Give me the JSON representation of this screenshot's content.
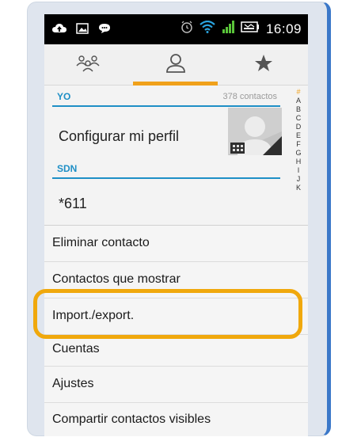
{
  "status_bar": {
    "time": "16:09",
    "left_icons": [
      "cloud-upload-icon",
      "image-icon",
      "chat-bubble-icon"
    ],
    "right_icons": [
      "alarm-icon",
      "wifi-icon",
      "signal-icon",
      "battery-icon"
    ]
  },
  "tabs": [
    {
      "icon": "groups-icon",
      "active": false
    },
    {
      "icon": "person-icon",
      "active": true
    },
    {
      "icon": "star-icon",
      "active": false
    }
  ],
  "contacts": {
    "sections": [
      {
        "title": "YO",
        "count": "378 contactos",
        "rows": [
          "Configurar mi perfil"
        ]
      },
      {
        "title": "SDN",
        "rows": [
          "*611"
        ]
      }
    ],
    "index_letters": [
      "#",
      "A",
      "B",
      "C",
      "D",
      "E",
      "F",
      "G",
      "H",
      "I",
      "J",
      "K"
    ]
  },
  "menu": {
    "items": [
      "Eliminar contacto",
      "Contactos que mostrar",
      "Import./export.",
      "Cuentas",
      "Ajustes",
      "Compartir contactos visibles"
    ],
    "highlighted": "Import./export."
  },
  "colors": {
    "accent_blue": "#1e8fc6",
    "tab_indicator": "#f0a11b",
    "highlight_border": "#f0a80c"
  }
}
